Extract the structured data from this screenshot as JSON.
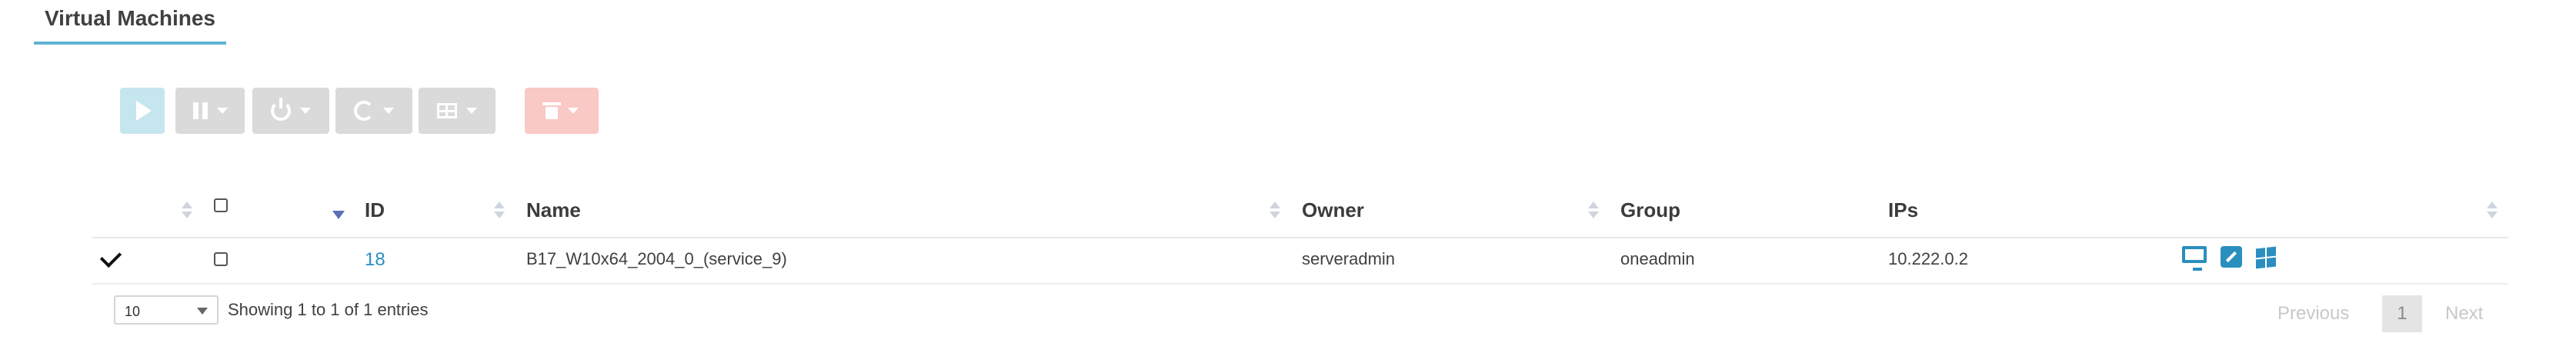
{
  "tab": {
    "title": "Virtual Machines"
  },
  "toolbar": {
    "play_icon": "play-icon",
    "pause_icon": "pause-icon",
    "power_icon": "power-icon",
    "refresh_icon": "refresh-icon",
    "table_icon": "table-icon",
    "delete_icon": "trash-icon",
    "colors": {
      "play": "#c6e6ef",
      "default": "#dadada",
      "delete": "#f8c9c5"
    }
  },
  "table": {
    "columns": [
      "ID",
      "Name",
      "Owner",
      "Group",
      "IPs"
    ],
    "rows": [
      {
        "selected": true,
        "id": "18",
        "name": "B17_W10x64_2004_0_(service_9)",
        "owner": "serveradmin",
        "group": "oneadmin",
        "ips": "10.222.0.2",
        "actions": [
          "monitor-icon",
          "external-link-icon",
          "windows-icon"
        ]
      }
    ]
  },
  "footer": {
    "page_size": "10",
    "info": "Showing 1 to 1 of 1 entries",
    "previous": "Previous",
    "current_page": "1",
    "next": "Next"
  },
  "colors": {
    "accent": "#2a8fbf",
    "tab_underline": "#5fb3d3"
  }
}
